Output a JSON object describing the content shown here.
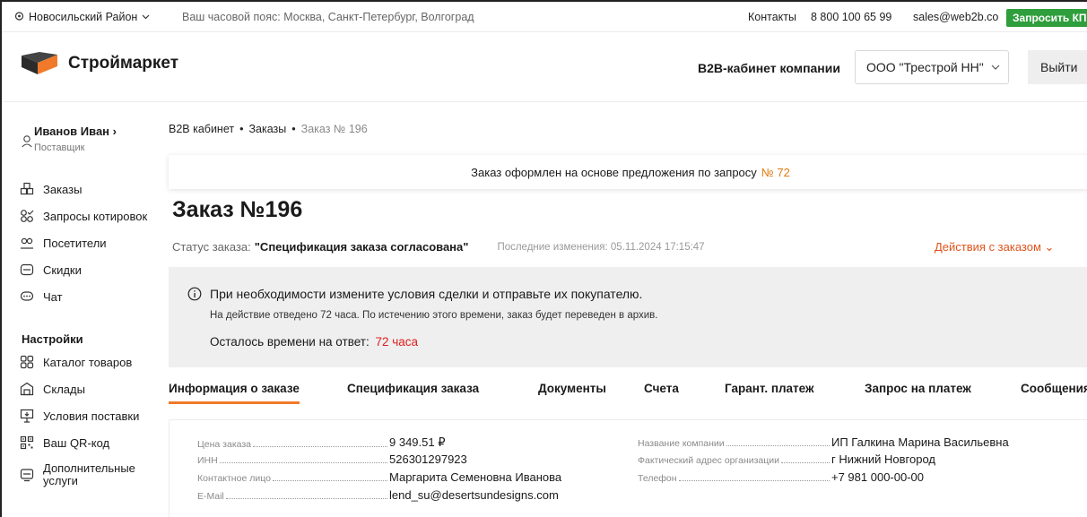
{
  "topbar": {
    "region": "Новосильский Район",
    "timezone": "Ваш часовой пояс: Москва, Санкт-Петербург, Волгоград",
    "contacts": "Контакты",
    "phone": "8 800 100 65 99",
    "email": "sales@web2b.co",
    "request_kp": "Запросить КП"
  },
  "header": {
    "logo_text": "Строймаркет",
    "b2b_label": "B2B-кабинет компании",
    "company": "ООО \"Трестрой НН\"",
    "logout": "Выйти"
  },
  "sidebar": {
    "user_name": "Иванов Иван",
    "user_role": "Поставщик",
    "items": [
      {
        "label": "Заказы",
        "icon": "orders-icon"
      },
      {
        "label": "Запросы котировок",
        "icon": "quotes-icon"
      },
      {
        "label": "Посетители",
        "icon": "visitors-icon"
      },
      {
        "label": "Скидки",
        "icon": "discounts-icon"
      },
      {
        "label": "Чат",
        "icon": "chat-icon"
      }
    ],
    "settings_title": "Настройки",
    "settings_items": [
      {
        "label": "Каталог товаров",
        "icon": "catalog-icon"
      },
      {
        "label": "Склады",
        "icon": "warehouse-icon"
      },
      {
        "label": "Условия поставки",
        "icon": "delivery-icon"
      },
      {
        "label": "Ваш QR-код",
        "icon": "qr-icon"
      },
      {
        "label": "Дополнительные",
        "label2": "услуги",
        "icon": "services-icon"
      }
    ]
  },
  "breadcrumb": [
    "B2B кабинет",
    "Заказы",
    "Заказ № 196"
  ],
  "offer_banner": {
    "text": "Заказ оформлен на основе предложения по запросу",
    "number": "№ 72"
  },
  "order": {
    "title": "Заказ №196",
    "status_label": "Статус заказа:",
    "status_value": "\"Спецификация заказа согласована\"",
    "last_change": "Последние изменения: 05.11.2024 17:15:47",
    "actions": "Действия с заказом"
  },
  "notice": {
    "main": "При необходимости измените условия сделки и отправьте их покупателю.",
    "sub": "На действие отведено 72 часа. По истечению этого времени, заказ будет переведен в архив.",
    "time_label": "Осталось времени на ответ:",
    "time_value": "72 часа"
  },
  "tabs": [
    "Информация о заказе",
    "Спецификация заказа",
    "Документы",
    "Счета",
    "Гарант. платеж",
    "Запрос на платеж",
    "Сообщения"
  ],
  "info_left": [
    {
      "label": "Цена заказа",
      "value": "9 349.51 ₽"
    },
    {
      "label": "ИНН",
      "value": "526301297923"
    },
    {
      "label": "Контактное лицо",
      "value": "Маргарита Семеновна Иванова"
    },
    {
      "label": "E-Mail",
      "value": "lend_su@desertsundesigns.com"
    }
  ],
  "info_right": [
    {
      "label": "Название компании",
      "value": "ИП Галкина Марина Васильевна"
    },
    {
      "label": "Фактический адрес организации",
      "value": "г Нижний Новгород"
    },
    {
      "label": "Телефон",
      "value": "+7 981 000-00-00"
    }
  ],
  "colors": {
    "accent": "#f07a2a",
    "green": "#2f9e3c",
    "red": "#e02020",
    "actions": "#e0541b"
  }
}
